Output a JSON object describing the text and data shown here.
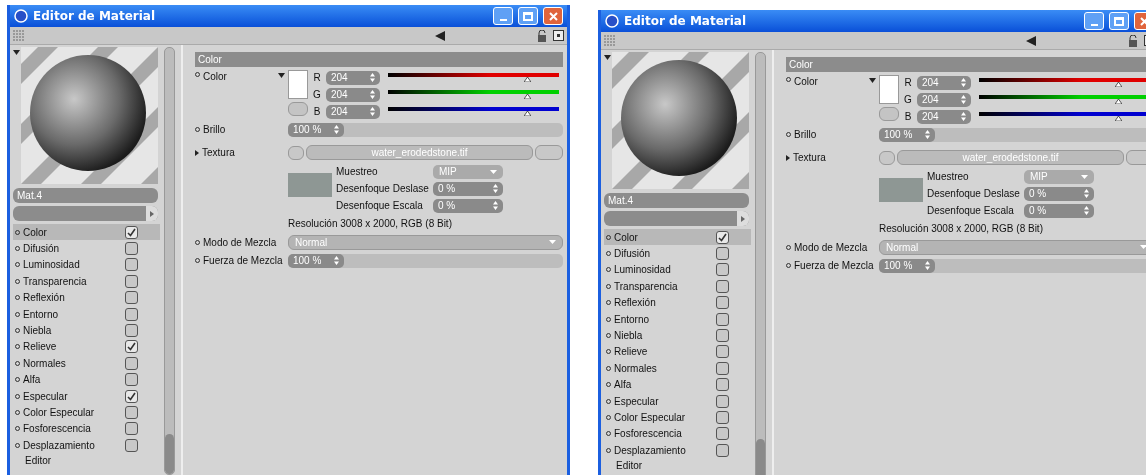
{
  "windows": [
    {
      "title": "Editor de Material",
      "material_name": "Mat.4",
      "panel_header": "Color",
      "color": {
        "label": "Color",
        "channels": [
          {
            "label": "R",
            "value": "204",
            "level": 0.8,
            "color": "#e00000"
          },
          {
            "label": "G",
            "value": "204",
            "level": 0.8,
            "color": "#00d000"
          },
          {
            "label": "B",
            "value": "204",
            "level": 0.8,
            "color": "#0000d0"
          }
        ]
      },
      "brillo": {
        "label": "Brillo",
        "value": "100 %"
      },
      "textura": {
        "label": "Textura",
        "file": "water_erodedstone.tif"
      },
      "texture_options": [
        {
          "label": "Muestreo",
          "value": "MIP",
          "kind": "dropdown"
        },
        {
          "label": "Desenfoque Deslase",
          "value": "0 %",
          "kind": "spinner"
        },
        {
          "label": "Desenfoque Escala",
          "value": "0 %",
          "kind": "spinner"
        }
      ],
      "resolution": "Resolución 3008 x 2000, RGB (8 Bit)",
      "modo": {
        "label": "Modo de Mezcla",
        "value": "Normal"
      },
      "fuerza": {
        "label": "Fuerza de Mezcla",
        "value": "100 %"
      },
      "channels": [
        {
          "label": "Color",
          "checked": true,
          "selected": true
        },
        {
          "label": "Difusión",
          "checked": false,
          "selected": false
        },
        {
          "label": "Luminosidad",
          "checked": false,
          "selected": false
        },
        {
          "label": "Transparencia",
          "checked": false,
          "selected": false
        },
        {
          "label": "Reflexión",
          "checked": false,
          "selected": false
        },
        {
          "label": "Entorno",
          "checked": false,
          "selected": false
        },
        {
          "label": "Niebla",
          "checked": false,
          "selected": false
        },
        {
          "label": "Relieve",
          "checked": true,
          "selected": false
        },
        {
          "label": "Normales",
          "checked": false,
          "selected": false
        },
        {
          "label": "Alfa",
          "checked": false,
          "selected": false
        },
        {
          "label": "Especular",
          "checked": true,
          "selected": false
        },
        {
          "label": "Color Especular",
          "checked": false,
          "selected": false
        },
        {
          "label": "Fosforescencia",
          "checked": false,
          "selected": false
        },
        {
          "label": "Desplazamiento",
          "checked": false,
          "selected": false
        }
      ],
      "footer_item": "Editor"
    },
    {
      "title": "Editor de Material",
      "material_name": "Mat.4",
      "panel_header": "Color",
      "color": {
        "label": "Color",
        "channels": [
          {
            "label": "R",
            "value": "204",
            "level": 0.8,
            "color": "#e00000"
          },
          {
            "label": "G",
            "value": "204",
            "level": 0.8,
            "color": "#00d000"
          },
          {
            "label": "B",
            "value": "204",
            "level": 0.8,
            "color": "#0000d0"
          }
        ]
      },
      "brillo": {
        "label": "Brillo",
        "value": "100 %"
      },
      "textura": {
        "label": "Textura",
        "file": "water_erodedstone.tif"
      },
      "texture_options": [
        {
          "label": "Muestreo",
          "value": "MIP",
          "kind": "dropdown"
        },
        {
          "label": "Desenfoque Deslase",
          "value": "0 %",
          "kind": "spinner"
        },
        {
          "label": "Desenfoque Escala",
          "value": "0 %",
          "kind": "spinner"
        }
      ],
      "resolution": "Resolución 3008 x 2000, RGB (8 Bit)",
      "modo": {
        "label": "Modo de Mezcla",
        "value": "Normal"
      },
      "fuerza": {
        "label": "Fuerza de Mezcla",
        "value": "100 %"
      },
      "channels": [
        {
          "label": "Color",
          "checked": true,
          "selected": true
        },
        {
          "label": "Difusión",
          "checked": false,
          "selected": false
        },
        {
          "label": "Luminosidad",
          "checked": false,
          "selected": false
        },
        {
          "label": "Transparencia",
          "checked": false,
          "selected": false
        },
        {
          "label": "Reflexión",
          "checked": false,
          "selected": false
        },
        {
          "label": "Entorno",
          "checked": false,
          "selected": false
        },
        {
          "label": "Niebla",
          "checked": false,
          "selected": false
        },
        {
          "label": "Relieve",
          "checked": false,
          "selected": false
        },
        {
          "label": "Normales",
          "checked": false,
          "selected": false
        },
        {
          "label": "Alfa",
          "checked": false,
          "selected": false
        },
        {
          "label": "Especular",
          "checked": false,
          "selected": false
        },
        {
          "label": "Color Especular",
          "checked": false,
          "selected": false
        },
        {
          "label": "Fosforescencia",
          "checked": false,
          "selected": false
        },
        {
          "label": "Desplazamiento",
          "checked": false,
          "selected": false
        }
      ],
      "footer_item": "Editor"
    }
  ]
}
